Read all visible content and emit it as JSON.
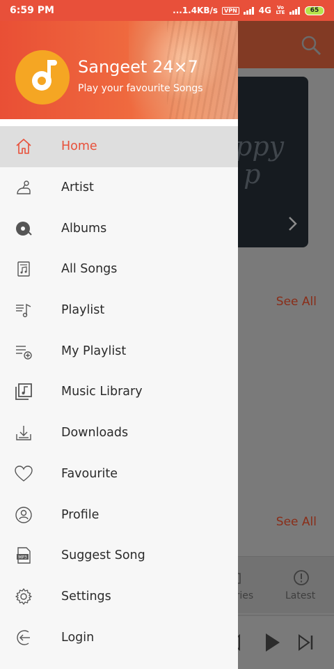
{
  "status_bar": {
    "time": "6:59 PM",
    "network_speed": "...1.4KB/s",
    "vpn": "VPN",
    "network": "4G",
    "volte": "Vo LTE",
    "battery": "65"
  },
  "drawer": {
    "app_name": "Sangeet 24×7",
    "tagline": "Play your favourite Songs",
    "items": [
      {
        "label": "Home",
        "icon": "home-icon",
        "active": true
      },
      {
        "label": "Artist",
        "icon": "artist-icon",
        "active": false
      },
      {
        "label": "Albums",
        "icon": "albums-icon",
        "active": false
      },
      {
        "label": "All Songs",
        "icon": "all-songs-icon",
        "active": false
      },
      {
        "label": "Playlist",
        "icon": "playlist-icon",
        "active": false
      },
      {
        "label": "My Playlist",
        "icon": "my-playlist-icon",
        "active": false
      },
      {
        "label": "Music Library",
        "icon": "music-library-icon",
        "active": false
      },
      {
        "label": "Downloads",
        "icon": "downloads-icon",
        "active": false
      },
      {
        "label": "Favourite",
        "icon": "heart-icon",
        "active": false
      },
      {
        "label": "Profile",
        "icon": "profile-icon",
        "active": false
      },
      {
        "label": "Suggest Song",
        "icon": "mp3-icon",
        "active": false
      },
      {
        "label": "Settings",
        "icon": "gear-icon",
        "active": false
      },
      {
        "label": "Login",
        "icon": "login-icon",
        "active": false
      }
    ]
  },
  "background": {
    "banner_text": "ppy\np",
    "see_all_1": "See All",
    "see_all_2": "See All",
    "tab_stories": "ories",
    "tab_latest": "Latest"
  },
  "colors": {
    "accent": "#e8503a",
    "logo": "#f5a623"
  }
}
